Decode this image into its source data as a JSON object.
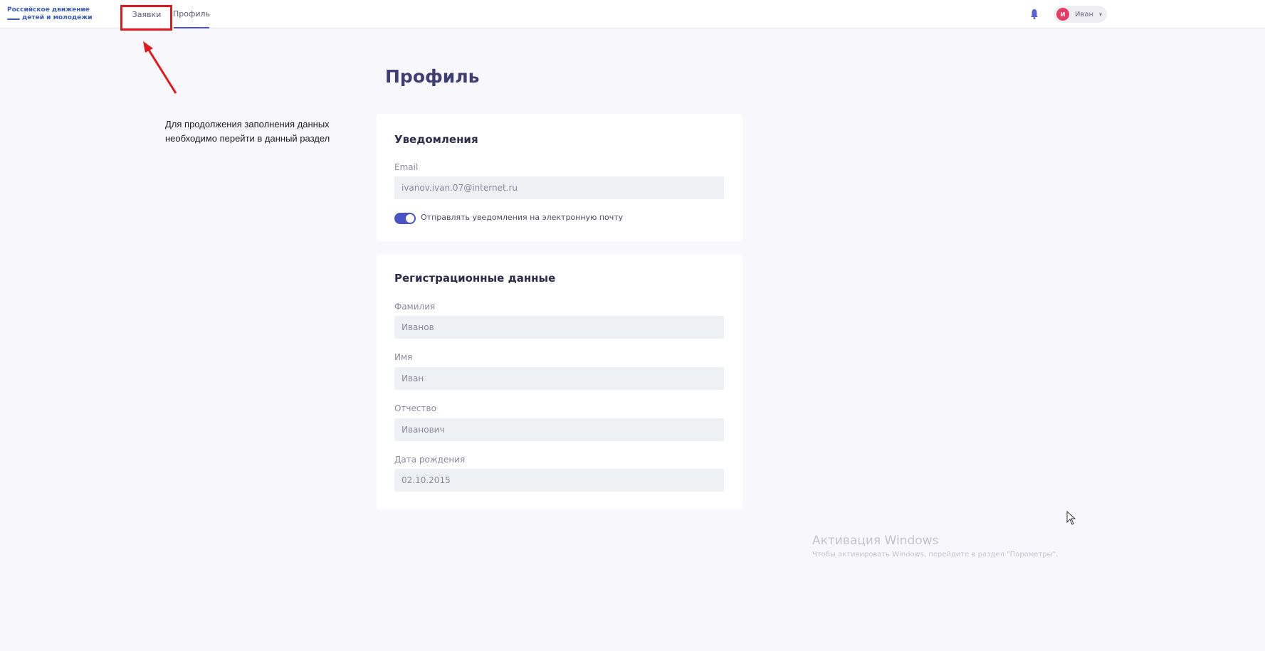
{
  "header": {
    "logo_line1": "Российское движение",
    "logo_line2": "детей и молодежи",
    "tabs": [
      {
        "label": "Заявки",
        "active": false
      },
      {
        "label": "Профиль",
        "active": true
      }
    ],
    "user": {
      "initial": "И",
      "name": "Иван"
    },
    "icons": [
      "bell-icon",
      "chevron-down-icon"
    ]
  },
  "annotation": {
    "hint_text": "Для продолжения заполнения данных необходимо перейти в данный раздел",
    "highlight_color": "#e0191d"
  },
  "page": {
    "title": "Профиль"
  },
  "notifications": {
    "title": "Уведомления",
    "email_label": "Email",
    "email_value": "ivanov.ivan.07@internet.ru",
    "toggle_label": "Отправлять уведомления на электронную почту",
    "toggle_on": true
  },
  "registration": {
    "title": "Регистрационные данные",
    "fields": [
      {
        "label": "Фамилия",
        "value": "Иванов"
      },
      {
        "label": "Имя",
        "value": "Иван"
      },
      {
        "label": "Отчество",
        "value": "Иванович"
      },
      {
        "label": "Дата рождения",
        "value": "02.10.2015"
      }
    ]
  },
  "windows_watermark": {
    "line1": "Активация Windows",
    "line2": "Чтобы активировать Windows, перейдите в раздел \"Параметры\"."
  },
  "colors": {
    "accent": "#4a52c4",
    "title": "#3e3e74",
    "avatar": "#e73b66"
  }
}
